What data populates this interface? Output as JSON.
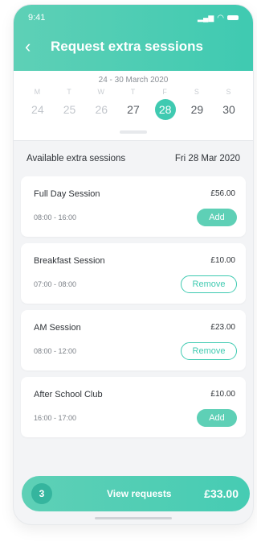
{
  "status": {
    "time": "9:41"
  },
  "header": {
    "title": "Request extra sessions",
    "back_icon": "‹"
  },
  "calendar": {
    "range": "24 - 30 March 2020",
    "daynames": [
      "M",
      "T",
      "W",
      "T",
      "F",
      "S",
      "S"
    ],
    "dates": [
      "24",
      "25",
      "26",
      "27",
      "28",
      "29",
      "30"
    ]
  },
  "section": {
    "title": "Available extra sessions",
    "date": "Fri 28 Mar 2020"
  },
  "sessions": [
    {
      "name": "Full Day Session",
      "price": "£56.00",
      "time": "08:00 - 16:00",
      "action": "Add"
    },
    {
      "name": "Breakfast Session",
      "price": "£10.00",
      "time": "07:00 - 08:00",
      "action": "Remove"
    },
    {
      "name": "AM Session",
      "price": "£23.00",
      "time": "08:00 - 12:00",
      "action": "Remove"
    },
    {
      "name": "After School Club",
      "price": "£10.00",
      "time": "16:00 - 17:00",
      "action": "Add"
    }
  ],
  "footer": {
    "count": "3",
    "label": "View requests",
    "total": "£33.00"
  },
  "colors": {
    "accent": "#3fcab1",
    "accent_light": "#5ed0b6"
  }
}
